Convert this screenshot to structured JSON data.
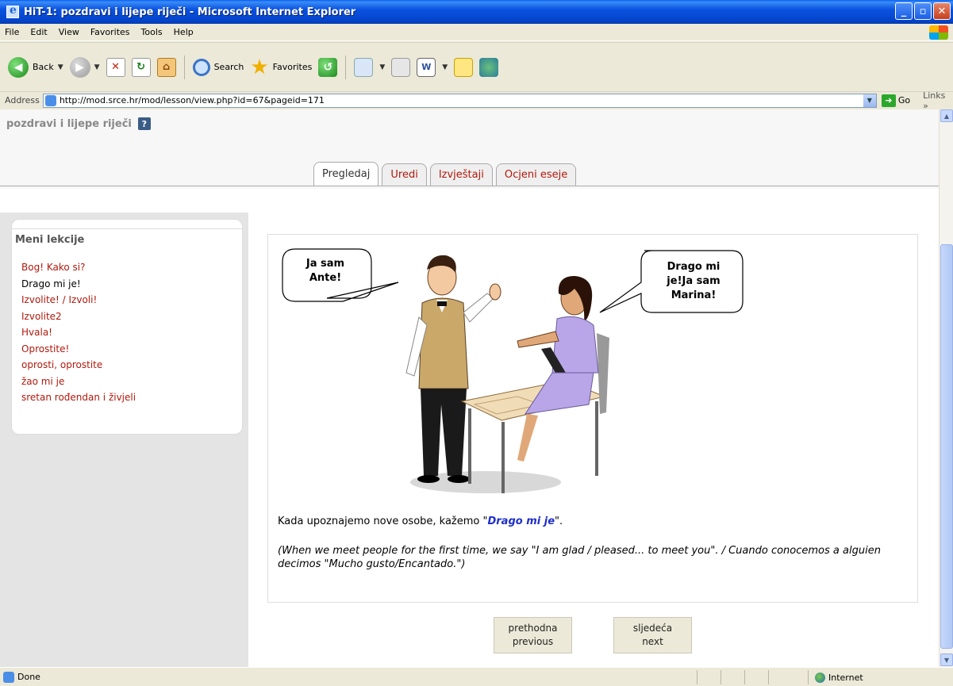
{
  "window": {
    "title": "HiT-1: pozdravi i lijepe riječi - Microsoft Internet Explorer",
    "buttons": {
      "minimize": "_",
      "maximize": "▫",
      "close": "✕"
    }
  },
  "menubar": {
    "items": [
      "File",
      "Edit",
      "View",
      "Favorites",
      "Tools",
      "Help"
    ]
  },
  "toolbar": {
    "back": "Back",
    "search": "Search",
    "favorites": "Favorites"
  },
  "addressbar": {
    "label": "Address",
    "url": "http://mod.srce.hr/mod/lesson/view.php?id=67&pageid=171",
    "go": "Go",
    "links": "Links"
  },
  "page": {
    "title": "pozdravi i lijepe riječi",
    "help_icon": "?",
    "tabs": [
      "Pregledaj",
      "Uredi",
      "Izvještaji",
      "Ocjeni eseje"
    ],
    "active_tab": "Pregledaj"
  },
  "lesson_menu": {
    "heading": "Meni lekcije",
    "items": [
      "Bog! Kako si?",
      "Drago mi je!",
      "Izvolite! / Izvoli!",
      "Izvolite2",
      "Hvala!",
      "Oprostite!",
      "oprosti, oprostite",
      "žao mi je",
      "sretan rođendan i živjeli"
    ],
    "current_index": 1
  },
  "content": {
    "bubble_left": [
      "Ja sam",
      "Ante!"
    ],
    "bubble_right": [
      "Drago mi",
      "je!Ja sam",
      "Marina!"
    ],
    "lesson_text_before": "Kada upoznajemo nove osobe, kažemo \"",
    "lesson_text_highlight": "Drago mi je",
    "lesson_text_after": "\".",
    "translation": "(When we meet people for the first time, we say  \"I am glad / pleased... to meet you\". / Cuando conocemos a alguien decimos \"Mucho gusto/Encantado.\")"
  },
  "navigation": {
    "previous": [
      "prethodna",
      "previous"
    ],
    "next": [
      "sljedeća",
      "next"
    ]
  },
  "statusbar": {
    "status": "Done",
    "zone": "Internet"
  },
  "colors": {
    "link": "#b0190d",
    "highlight": "#1e2fc8",
    "titlebar": "#0a52e0"
  }
}
